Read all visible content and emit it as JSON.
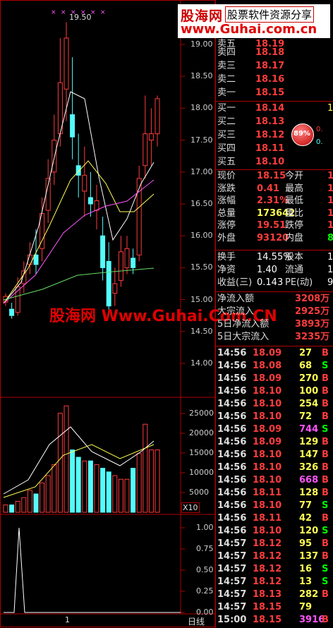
{
  "watermark": {
    "brand": "股海网",
    "slogan": "股票软件资源分享",
    "url": "www.Guhai.com.cn",
    "center_text": "股海网 Www.Guhai.Com.CN"
  },
  "top_marker": "19.50",
  "price_axis": [
    "19.00",
    "18.50",
    "18.00",
    "17.50",
    "17.00",
    "16.50",
    "16.00",
    "15.50",
    "15.00",
    "14.50",
    "14.00"
  ],
  "volume_axis": [
    "25000",
    "20000",
    "15000",
    "10000",
    "5000"
  ],
  "volume_unit": "X10",
  "indicator_axis": [
    "1.00",
    "0.75",
    "0.50",
    "0.25",
    "0.00"
  ],
  "bottom": {
    "cursor_label": "1",
    "period": "日线"
  },
  "sell_levels": [
    {
      "label": "卖四",
      "price": "18.18"
    },
    {
      "label": "卖三",
      "price": "18.17"
    },
    {
      "label": "卖二",
      "price": "18.16"
    },
    {
      "label": "卖一",
      "price": "18.15"
    }
  ],
  "buy_levels": [
    {
      "label": "买一",
      "price": "18.14",
      "extra": "1"
    },
    {
      "label": "买二",
      "price": "18.13",
      "extra": ""
    },
    {
      "label": "买三",
      "price": "18.12",
      "extra": ""
    },
    {
      "label": "买四",
      "price": "18.11",
      "extra": ""
    },
    {
      "label": "买五",
      "price": "18.10",
      "extra": ""
    }
  ],
  "badge": {
    "percent": "89%",
    "up": "0.",
    "down": "0."
  },
  "quote": [
    {
      "l1": "现价",
      "v1": "18.15",
      "l2": "今开",
      "v2": "17"
    },
    {
      "l1": "涨跌",
      "v1": "0.41",
      "l2": "最高",
      "v2": "18"
    },
    {
      "l1": "涨幅",
      "v1": "2.31%",
      "l2": "最低",
      "v2": "17"
    },
    {
      "l1": "总量",
      "v1": "173642",
      "l2": "量比",
      "v2": "1"
    },
    {
      "l1": "涨停",
      "v1": "19.51",
      "l2": "跌停",
      "v2": "15"
    },
    {
      "l1": "外盘",
      "v1": "93120",
      "l2": "内盘",
      "v2": "80"
    }
  ],
  "stats": [
    {
      "l1": "换手",
      "v1": "14.55%",
      "l2": "股本",
      "v2": "1.3"
    },
    {
      "l1": "净资",
      "v1": "1.40",
      "l2": "流通",
      "v2": "1.1"
    },
    {
      "l1": "收益(三)",
      "v1": "0.143",
      "l2": "PE(动)",
      "v2": "9"
    }
  ],
  "flows": [
    {
      "label": "净流入额",
      "value": "3208万"
    },
    {
      "label": "大宗流入",
      "value": "2925万"
    },
    {
      "label": "5日净流入额",
      "value": "3893万"
    },
    {
      "label": "5日大宗流入",
      "value": "3235万"
    }
  ],
  "ticks": [
    {
      "time": "14:56",
      "price": "18.09",
      "vol": "27",
      "side": "B"
    },
    {
      "time": "14:56",
      "price": "18.08",
      "vol": "68",
      "side": "S"
    },
    {
      "time": "14:56",
      "price": "18.09",
      "vol": "270",
      "side": "B"
    },
    {
      "time": "14:56",
      "price": "18.10",
      "vol": "100",
      "side": "B"
    },
    {
      "time": "14:56",
      "price": "18.10",
      "vol": "254",
      "side": "B"
    },
    {
      "time": "14:56",
      "price": "18.10",
      "vol": "72",
      "side": "B"
    },
    {
      "time": "14:56",
      "price": "18.09",
      "vol": "744",
      "side": "S"
    },
    {
      "time": "14:56",
      "price": "18.09",
      "vol": "129",
      "side": "B"
    },
    {
      "time": "14:56",
      "price": "18.10",
      "vol": "147",
      "side": "B"
    },
    {
      "time": "14:56",
      "price": "18.10",
      "vol": "326",
      "side": "B"
    },
    {
      "time": "14:56",
      "price": "18.10",
      "vol": "668",
      "side": "B"
    },
    {
      "time": "14:56",
      "price": "18.11",
      "vol": "128",
      "side": "B"
    },
    {
      "time": "14:56",
      "price": "18.10",
      "vol": "77",
      "side": "S"
    },
    {
      "time": "14:56",
      "price": "18.11",
      "vol": "42",
      "side": "B"
    },
    {
      "time": "14:56",
      "price": "18.10",
      "vol": "120",
      "side": "S"
    },
    {
      "time": "14:57",
      "price": "18.12",
      "vol": "95",
      "side": "B"
    },
    {
      "time": "14:57",
      "price": "18.12",
      "vol": "137",
      "side": "B"
    },
    {
      "time": "14:57",
      "price": "18.12",
      "vol": "16",
      "side": "S"
    },
    {
      "time": "14:57",
      "price": "18.12",
      "vol": "13",
      "side": "S"
    },
    {
      "time": "14:57",
      "price": "18.13",
      "vol": "282",
      "side": "B"
    },
    {
      "time": "14:57",
      "price": "18.15",
      "vol": "79",
      "side": ""
    },
    {
      "time": "15:00",
      "price": "18.15",
      "vol": "3916",
      "side": "B"
    }
  ],
  "colors": {
    "up": "#ff3c3c",
    "down": "#54fcfc",
    "yellow": "#ffff54",
    "grid": "#8b0000",
    "border": "#b00000",
    "magenta": "#ff54ff"
  }
}
